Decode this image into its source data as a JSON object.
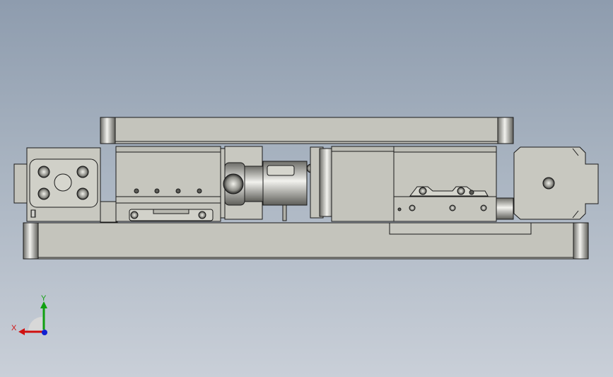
{
  "viewport": {
    "background_top": "#8e9cae",
    "background_bottom": "#c9cfd8",
    "model_face_color": "#c4c4bc",
    "model_edge_color": "#1a1a1a"
  },
  "model": {
    "parts": [
      {
        "name": "top-plate"
      },
      {
        "name": "base-plate"
      },
      {
        "name": "left-end-block"
      },
      {
        "name": "left-carriage"
      },
      {
        "name": "coupling"
      },
      {
        "name": "motor"
      },
      {
        "name": "right-carriage"
      },
      {
        "name": "right-end-block"
      }
    ]
  },
  "triad": {
    "x_label": "X",
    "y_label": "Y",
    "x_color": "#d01010",
    "y_color": "#10a010",
    "z_color": "#1020d0"
  }
}
